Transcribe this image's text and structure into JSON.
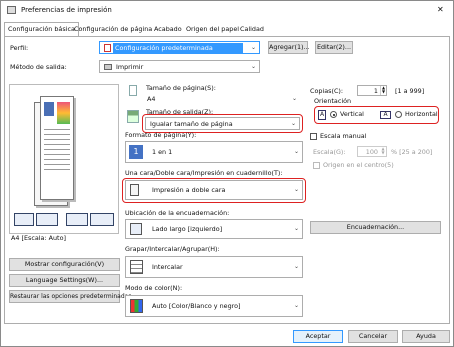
{
  "window": {
    "title": "Preferencias de impresión",
    "close_glyph": "✕"
  },
  "tabs": [
    "Configuración básica",
    "Configuración de página",
    "Acabado",
    "Origen del papel",
    "Calidad"
  ],
  "profile": {
    "label": "Perfil:",
    "value": "Configuración predeterminada",
    "add_label": "Agregar(1)...",
    "edit_label": "Editar(2)..."
  },
  "output_method": {
    "label": "Método de salida:",
    "value": "Imprimir"
  },
  "page_size": {
    "label": "Tamaño de página(S):",
    "value": "A4"
  },
  "output_size": {
    "label": "Tamaño de salida(Z):",
    "value": "Igualar tamaño de página"
  },
  "copies": {
    "label": "Copias(C):",
    "value": "1",
    "range": "[1 a 999]"
  },
  "orientation": {
    "label": "Orientación",
    "portrait_label": "Vertical",
    "landscape_label": "Horizontal",
    "selected": "portrait"
  },
  "page_layout": {
    "label": "Formato de página(Y):",
    "value": "1 en 1"
  },
  "manual_scaling": {
    "label": "Escala manual",
    "scale_label": "Escala(G):",
    "scale_value": "100",
    "scale_range": "% [25 a 200]",
    "center_label": "Origen en el centro(5)"
  },
  "duplex": {
    "label": "Una cara/Doble cara/Impresión en cuadernillo(T):",
    "value": "Impresión a doble cara"
  },
  "binding": {
    "label": "Ubicación de la encuadernación:",
    "value": "Lado largo [izquierdo]",
    "button_label": "Encuadernación..."
  },
  "staple": {
    "label": "Grapar/Intercalar/Agrupar(H):",
    "value": "Intercalar"
  },
  "color_mode": {
    "label": "Modo de color(N):",
    "value": "Auto [Color/Blanco y negro]"
  },
  "preview": {
    "caption": "A4 [Escala: Auto]"
  },
  "left_buttons": {
    "show_settings": "Mostrar configuración(V)",
    "language_settings": "Language Settings(W)...",
    "restore_defaults": "Restaurar las opciones predeterminadas"
  },
  "footer": {
    "ok": "Aceptar",
    "cancel": "Cancelar",
    "help": "Ayuda"
  },
  "colors": {
    "highlight": "#d22222",
    "selection": "#3399ff"
  }
}
